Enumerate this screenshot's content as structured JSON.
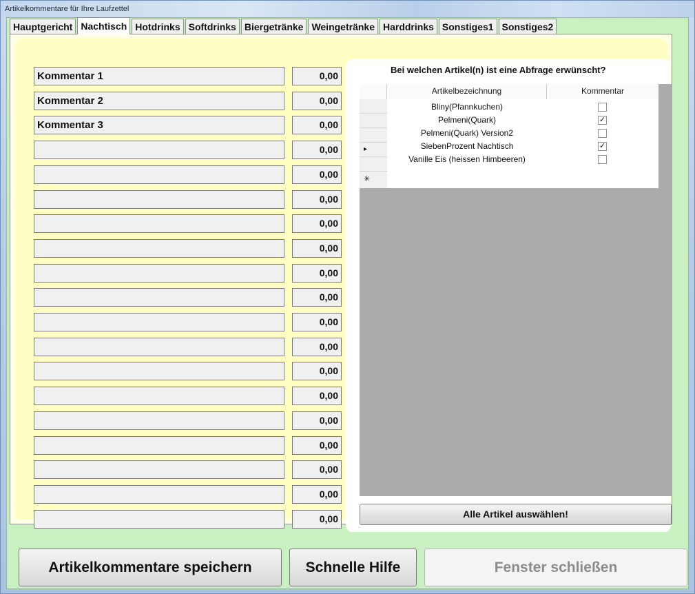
{
  "window": {
    "title": "Artikelkommentare für Ihre Laufzettel"
  },
  "tabs": [
    {
      "label": "Hauptgericht",
      "active": false
    },
    {
      "label": "Nachtisch",
      "active": true
    },
    {
      "label": "Hotdrinks",
      "active": false
    },
    {
      "label": "Softdrinks",
      "active": false
    },
    {
      "label": "Biergetränke",
      "active": false
    },
    {
      "label": "Weingetränke",
      "active": false
    },
    {
      "label": "Harddrinks",
      "active": false
    },
    {
      "label": "Sonstiges1",
      "active": false
    },
    {
      "label": "Sonstiges2",
      "active": false
    }
  ],
  "comments": [
    {
      "name": "Kommentar 1",
      "value": "0,00"
    },
    {
      "name": "Kommentar 2",
      "value": "0,00"
    },
    {
      "name": "Kommentar 3",
      "value": "0,00"
    },
    {
      "name": "",
      "value": "0,00"
    },
    {
      "name": "",
      "value": "0,00"
    },
    {
      "name": "",
      "value": "0,00"
    },
    {
      "name": "",
      "value": "0,00"
    },
    {
      "name": "",
      "value": "0,00"
    },
    {
      "name": "",
      "value": "0,00"
    },
    {
      "name": "",
      "value": "0,00"
    },
    {
      "name": "",
      "value": "0,00"
    },
    {
      "name": "",
      "value": "0,00"
    },
    {
      "name": "",
      "value": "0,00"
    },
    {
      "name": "",
      "value": "0,00"
    },
    {
      "name": "",
      "value": "0,00"
    },
    {
      "name": "",
      "value": "0,00"
    },
    {
      "name": "",
      "value": "0,00"
    },
    {
      "name": "",
      "value": "0,00"
    },
    {
      "name": "",
      "value": "0,00"
    }
  ],
  "article_panel": {
    "question": "Bei welchen Artikel(n) ist eine Abfrage erwünscht?",
    "columns": [
      "Artikelbezeichnung",
      "Kommentar"
    ],
    "rows": [
      {
        "name": "Bliny(Pfannkuchen)",
        "checked": false,
        "current": false
      },
      {
        "name": "Pelmeni(Quark)",
        "checked": true,
        "current": false
      },
      {
        "name": "Pelmeni(Quark) Version2",
        "checked": false,
        "current": false
      },
      {
        "name": "SiebenProzent Nachtisch",
        "checked": true,
        "current": true
      },
      {
        "name": "Vanille Eis (heissen Himbeeren)",
        "checked": false,
        "current": false
      }
    ],
    "current_row_marker": "▸",
    "new_row_marker": "✳",
    "check_glyph": "✓",
    "select_all_label": "Alle Artikel auswählen!"
  },
  "buttons": {
    "save": "Artikelkommentare speichern",
    "help": "Schnelle Hilfe",
    "close": "Fenster schließen"
  },
  "colors": {
    "client_bg": "#c8f0c0",
    "panel_yellow": "#ffffc4",
    "grid_gray": "#ababab"
  }
}
